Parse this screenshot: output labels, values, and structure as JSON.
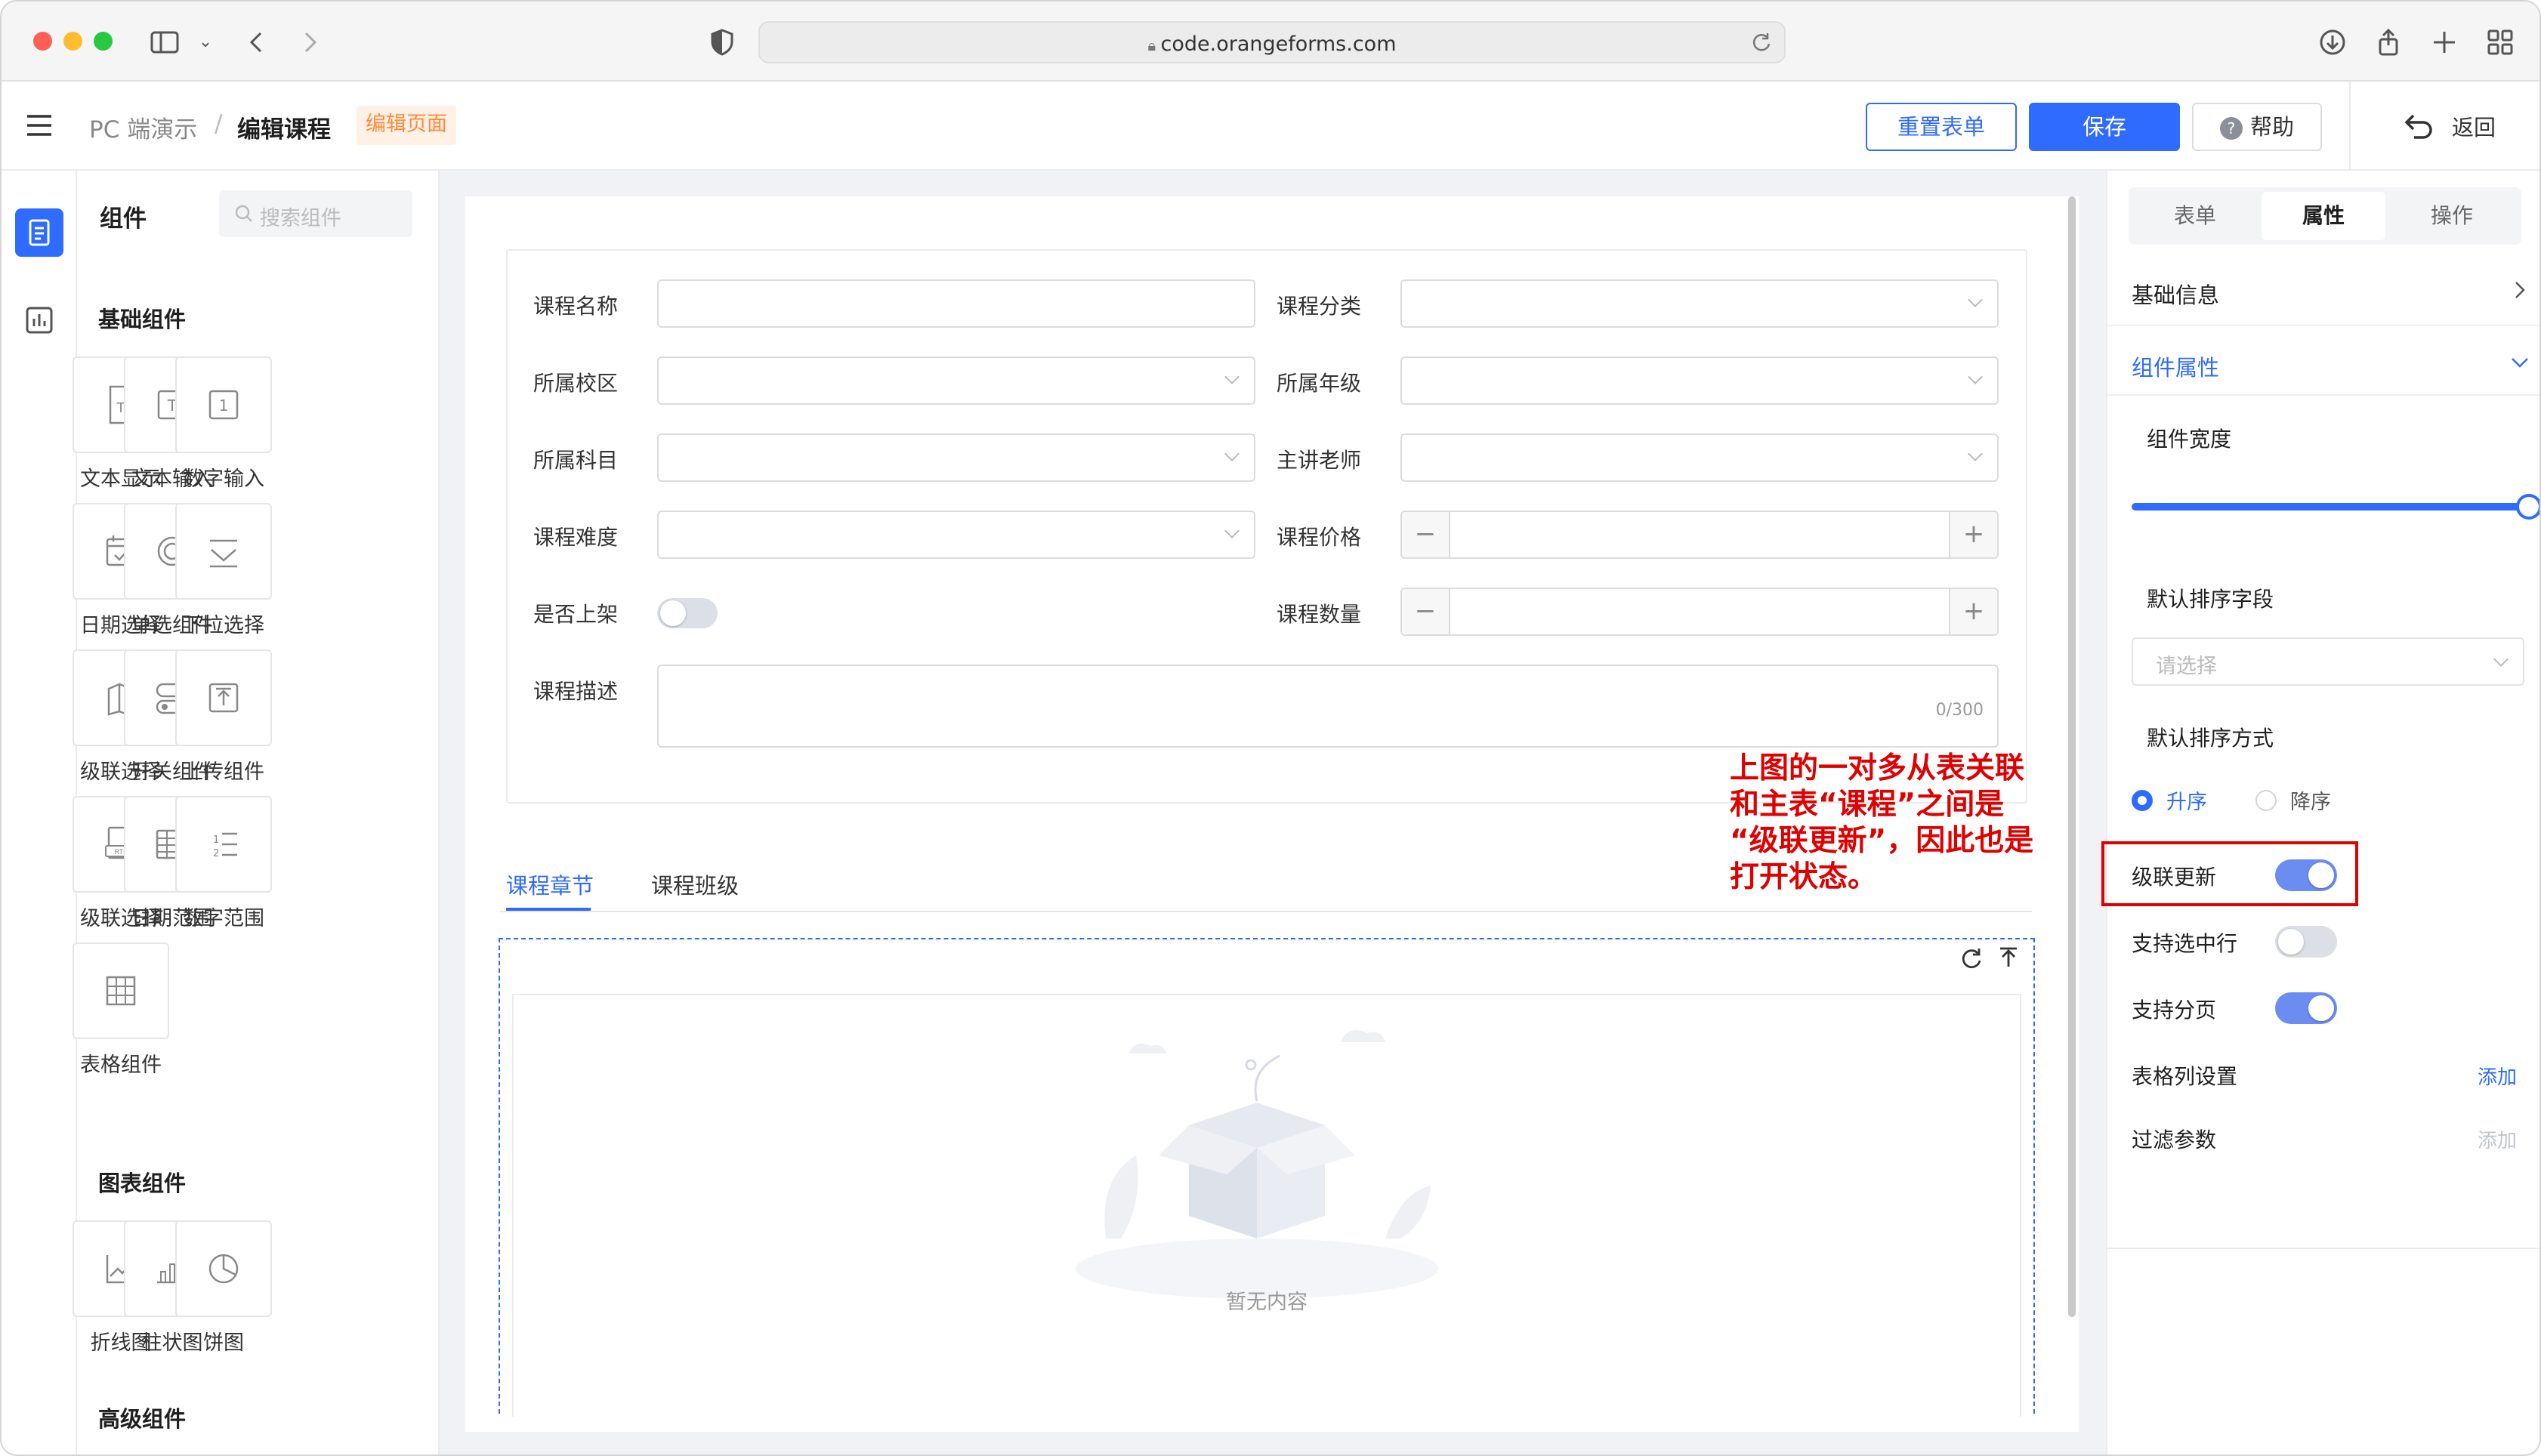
{
  "browser": {
    "url": "code.orangeforms.com"
  },
  "header": {
    "breadcrumb_root": "PC 端演示",
    "breadcrumb_sep": "/",
    "breadcrumb_current": "编辑课程",
    "badge": "编辑页面",
    "reset_label": "重置表单",
    "save_label": "保存",
    "help_label": "帮助",
    "back_label": "返回"
  },
  "components": {
    "title": "组件",
    "search_placeholder": "搜索组件",
    "basic_title": "基础组件",
    "basic_items": [
      "文本显示",
      "文本输入",
      "数字输入",
      "日期选择",
      "单选组件",
      "下拉选择",
      "级联选择",
      "开关组件",
      "上传组件",
      "级联选择",
      "日期范围",
      "数字范围",
      "表格组件"
    ],
    "chart_title": "图表组件",
    "chart_items": [
      "折线图",
      "柱状图",
      "饼图"
    ],
    "advanced_title": "高级组件"
  },
  "form": {
    "labels": [
      "课程名称",
      "课程分类",
      "所属校区",
      "所属年级",
      "所属科目",
      "主讲老师",
      "课程难度",
      "课程价格",
      "是否上架",
      "课程数量",
      "课程描述"
    ],
    "textarea_counter": "0/300",
    "stepper_minus": "−",
    "stepper_plus": "+",
    "tabs": [
      "课程章节",
      "课程班级"
    ],
    "empty_text": "暂无内容"
  },
  "annotation": {
    "lines": [
      "上图的一对多从表关联",
      "和主表“课程”之间是",
      "“级联更新”，因此也是",
      "打开状态。"
    ]
  },
  "props": {
    "tabs": [
      "表单",
      "属性",
      "操作"
    ],
    "active_tab": "属性",
    "basic_info": "基础信息",
    "comp_props": "组件属性",
    "width_label": "组件宽度",
    "width_value": 1.0,
    "sort_field_label": "默认排序字段",
    "sort_field_placeholder": "请选择",
    "sort_mode_label": "默认排序方式",
    "asc": "升序",
    "desc": "降序",
    "cascade_update": "级联更新",
    "cascade_update_on": true,
    "select_row": "支持选中行",
    "select_row_on": false,
    "paging": "支持分页",
    "paging_on": true,
    "columns_label": "表格列设置",
    "columns_add": "添加",
    "filter_label": "过滤参数",
    "filter_add": "添加"
  },
  "colors": {
    "primary": "#2f6bff",
    "annotation": "#e00000",
    "badge_bg": "#fff1e6",
    "badge_fg": "#ff8a3d",
    "toggle_on": "#6b8df2"
  }
}
